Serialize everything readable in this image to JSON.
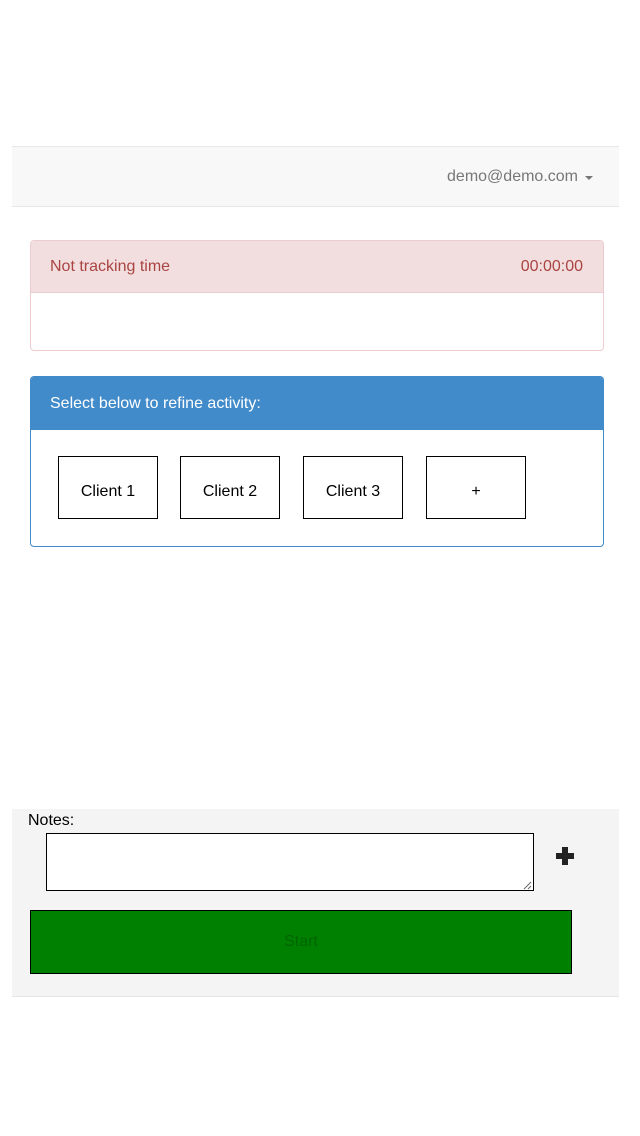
{
  "navbar": {
    "user_email": "demo@demo.com",
    "caret_icon": "caret-down-icon"
  },
  "status": {
    "label": "Not tracking time",
    "timer": "00:00:00",
    "color": "#a94442",
    "background": "#f2dede"
  },
  "activity": {
    "heading": "Select below to refine activity:",
    "heading_background": "#428bca",
    "clients": [
      {
        "label": "Client 1"
      },
      {
        "label": "Client 2"
      },
      {
        "label": "Client 3"
      }
    ],
    "add_label": "+"
  },
  "footer": {
    "notes_label": "Notes:",
    "notes_value": "",
    "add_icon": "plus-icon",
    "start_label": "Start",
    "start_color": "#008000"
  }
}
